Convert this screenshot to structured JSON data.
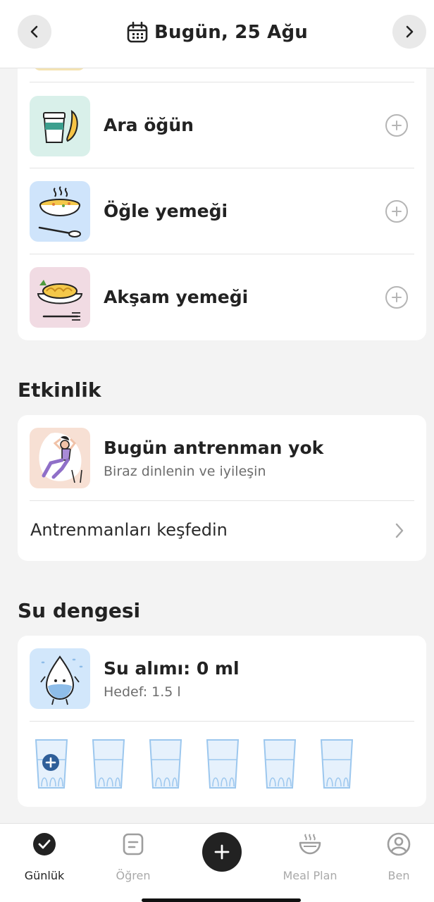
{
  "header": {
    "title": "Bugün, 25 Ağu",
    "prev_icon": "chevron-left-icon",
    "next_icon": "chevron-right-icon",
    "calendar_icon": "calendar-icon"
  },
  "meals": [
    {
      "title": "Ara öğün",
      "icon": "snack-icon",
      "bg": "#d9f0ea"
    },
    {
      "title": "Öğle yemeği",
      "icon": "soup-bowl-icon",
      "bg": "#cfe4fb"
    },
    {
      "title": "Akşam yemeği",
      "icon": "pasta-dish-icon",
      "bg": "#f1dbe3"
    }
  ],
  "activity": {
    "section_title": "Etkinlik",
    "title": "Bugün antrenman yok",
    "subtitle": "Biraz dinlenin ve iyileşin",
    "explore_label": "Antrenmanları keşfedin",
    "icon": "relaxing-person-icon"
  },
  "water": {
    "section_title": "Su dengesi",
    "title": "Su alımı: 0 ml",
    "subtitle": "Hedef: 1.5 l",
    "glasses_total": 6,
    "glasses_filled": 0,
    "icon": "water-drop-icon"
  },
  "tabs": [
    {
      "label": "Günlük",
      "icon": "check-circle-icon",
      "active": true
    },
    {
      "label": "Öğren",
      "icon": "article-icon",
      "active": false
    },
    {
      "label": "",
      "icon": "plus-icon",
      "active": false
    },
    {
      "label": "Meal Plan",
      "icon": "bowl-icon",
      "active": false
    },
    {
      "label": "Ben",
      "icon": "profile-icon",
      "active": false
    }
  ],
  "colors": {
    "accent_dark": "#222222",
    "muted": "#a9a9a9",
    "water_blue": "#9cc7ee",
    "plus_badge": "#2f5f99"
  }
}
